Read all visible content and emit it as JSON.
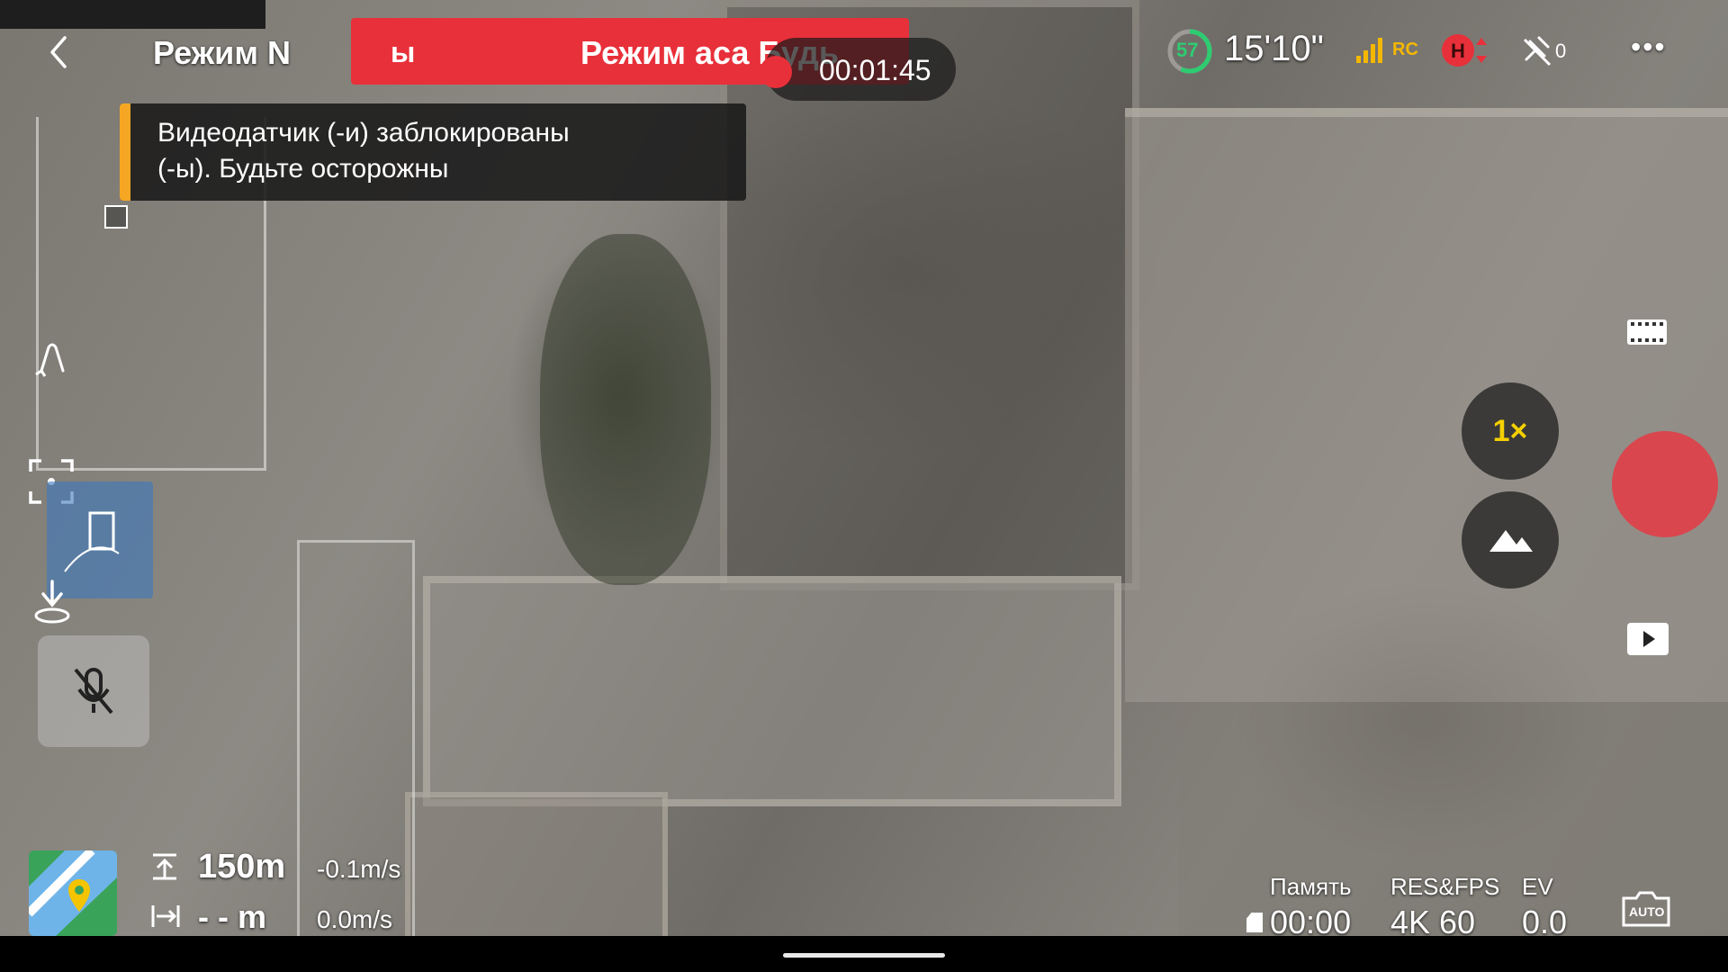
{
  "header": {
    "back_label": "<",
    "mode_label": "Режим N",
    "banner_left": "ы",
    "banner_text": "Режим аса Будь",
    "rec_time": "00:01:45"
  },
  "status": {
    "battery_percent": "57",
    "flight_time": "15'10\"",
    "signal_label": "RC",
    "sat_count": "0",
    "more_label": "•••"
  },
  "warning": {
    "line1": "Видеодатчик (-и) заблокированы",
    "line2": "(-ы). Будьте осторожны"
  },
  "camera": {
    "zoom_label": "1×",
    "auto_label": "AUTO"
  },
  "telemetry": {
    "altitude": "150m",
    "vspeed": "-0.1m/s",
    "distance": "- - m",
    "hspeed": "0.0m/s"
  },
  "bottom_right": {
    "memory_label": "Память",
    "memory_value": "00:00",
    "resfps_label": "RES&FPS",
    "resfps_value": "4K 60",
    "ev_label": "EV",
    "ev_value": "0.0"
  },
  "icons": [
    "back-icon",
    "shutter-stop-icon",
    "battery-ring-icon",
    "signal-icon",
    "obstacle-icon",
    "gps-icon",
    "more-icon",
    "film-icon",
    "play-icon",
    "camera-auto-icon",
    "mic-muted-icon",
    "focus-icon",
    "return-home-icon",
    "map-icon",
    "altitude-icon",
    "distance-icon",
    "landing-icon"
  ],
  "colors": {
    "banner_red": "#e8303a",
    "warning_bar": "#f5a623",
    "shutter_red": "#d9464e",
    "battery_green": "#2ecc71",
    "zoom_yellow": "#f5d000"
  }
}
